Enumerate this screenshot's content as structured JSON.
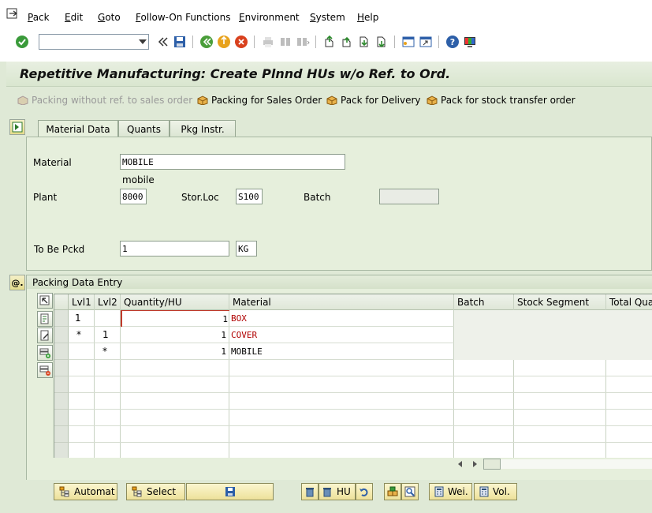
{
  "menu": {
    "items": [
      "Pack",
      "Edit",
      "Goto",
      "Follow-On Functions",
      "Environment",
      "System",
      "Help"
    ]
  },
  "toolbar": {
    "command_value": "",
    "icons": [
      "enter-icon",
      "back-icon",
      "save-icon",
      "nav-back-icon",
      "exit-icon",
      "cancel-icon",
      "print-icon",
      "find-icon",
      "find-next-icon",
      "first-page-icon",
      "prev-page-icon",
      "next-page-icon",
      "last-page-icon",
      "new-session-icon",
      "shortcut-icon",
      "help-icon",
      "customize-icon"
    ]
  },
  "title": "Repetitive Manufacturing: Create Plnnd HUs w/o Ref. to Ord.",
  "app_toolbar": {
    "btn1": "Packing without ref. to sales order",
    "btn2": "Packing for Sales Order",
    "btn3": "Pack for Delivery",
    "btn4": "Pack for stock transfer order"
  },
  "tabs": [
    "Material Data",
    "Quants",
    "Pkg Instr."
  ],
  "material_data": {
    "material_label": "Material",
    "material_value": "MOBILE",
    "material_desc": "mobile",
    "plant_label": "Plant",
    "plant_value": "8000",
    "storloc_label": "Stor.Loc",
    "storloc_value": "S100",
    "batch_label": "Batch",
    "batch_value": "",
    "tobepckd_label": "To Be Pckd",
    "tobepckd_value": "1",
    "unit_value": "KG"
  },
  "packing": {
    "section_title": "Packing Data Entry",
    "columns": [
      "Lvl1",
      "Lvl2",
      "Quantity/HU",
      "Material",
      "Batch",
      "Stock Segment",
      "Total Quan"
    ],
    "rows": [
      {
        "lvl1": "1",
        "lvl2": "",
        "qty": "1",
        "material": "BOX"
      },
      {
        "lvl1": "*",
        "lvl2": "1",
        "qty": "1",
        "material": "COVER"
      },
      {
        "lvl1": "",
        "lvl2": "*",
        "qty": "1",
        "material": "MOBILE"
      }
    ]
  },
  "bottom": {
    "automat": "Automat",
    "select": "Select",
    "hu": "HU",
    "wei": "Wei.",
    "vol": "Vol."
  },
  "colors": {
    "background": "#dfe9d6",
    "button_yellow": "#ede19a",
    "red_text": "#b00000"
  }
}
